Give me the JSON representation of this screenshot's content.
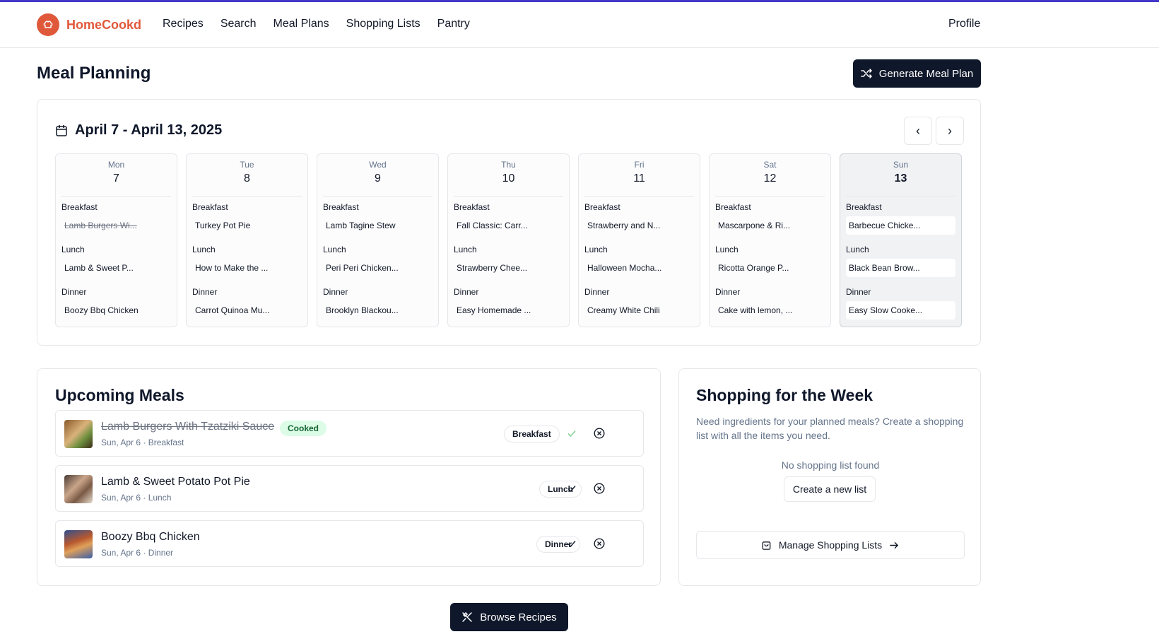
{
  "app": {
    "name": "HomeCookd",
    "brand_color": "#e0583a",
    "accent": "#4338ca"
  },
  "nav": {
    "links": [
      "Recipes",
      "Search",
      "Meal Plans",
      "Shopping Lists",
      "Pantry"
    ],
    "profile": "Profile"
  },
  "page": {
    "title": "Meal Planning",
    "generate_label": "Generate Meal Plan"
  },
  "week": {
    "range": "April 7 - April 13, 2025",
    "slot_labels": {
      "breakfast": "Breakfast",
      "lunch": "Lunch",
      "dinner": "Dinner"
    },
    "days": [
      {
        "name": "Mon",
        "num": "7",
        "breakfast": "Lamb Burgers Wi...",
        "lunch": "Lamb & Sweet P...",
        "dinner": "Boozy Bbq Chicken"
      },
      {
        "name": "Tue",
        "num": "8",
        "breakfast": "Turkey Pot Pie",
        "lunch": "How to Make the ...",
        "dinner": "Carrot Quinoa Mu..."
      },
      {
        "name": "Wed",
        "num": "9",
        "breakfast": "Lamb Tagine Stew",
        "lunch": "Peri Peri Chicken...",
        "dinner": "Brooklyn Blackou..."
      },
      {
        "name": "Thu",
        "num": "10",
        "breakfast": "Fall Classic: Carr...",
        "lunch": "Strawberry Chee...",
        "dinner": "Easy Homemade ..."
      },
      {
        "name": "Fri",
        "num": "11",
        "breakfast": "Strawberry and N...",
        "lunch": "Halloween Mocha...",
        "dinner": "Creamy White Chili"
      },
      {
        "name": "Sat",
        "num": "12",
        "breakfast": "Mascarpone & Ri...",
        "lunch": "Ricotta Orange P...",
        "dinner": "Cake with lemon, ..."
      },
      {
        "name": "Sun",
        "num": "13",
        "breakfast": "Barbecue Chicke...",
        "lunch": "Black Bean Brow...",
        "dinner": "Easy Slow Cooke..."
      }
    ]
  },
  "upcoming": {
    "title": "Upcoming Meals",
    "meals": [
      {
        "name": "Lamb Burgers With Tzatziki Sauce",
        "badge": "Cooked",
        "sub": "Sun, Apr 6 · Breakfast",
        "type": "Breakfast"
      },
      {
        "name": "Lamb & Sweet Potato Pot Pie",
        "sub": "Sun, Apr 6 · Lunch",
        "type": "Lunch"
      },
      {
        "name": "Boozy Bbq Chicken",
        "sub": "Sun, Apr 6 · Dinner",
        "type": "Dinner"
      }
    ]
  },
  "shopping": {
    "title": "Shopping for the Week",
    "description": "Need ingredients for your planned meals? Create a shopping list with all the items you need.",
    "empty": "No shopping list found",
    "create_label": "Create a new list",
    "manage_label": "Manage Shopping Lists"
  },
  "browse_label": "Browse Recipes"
}
